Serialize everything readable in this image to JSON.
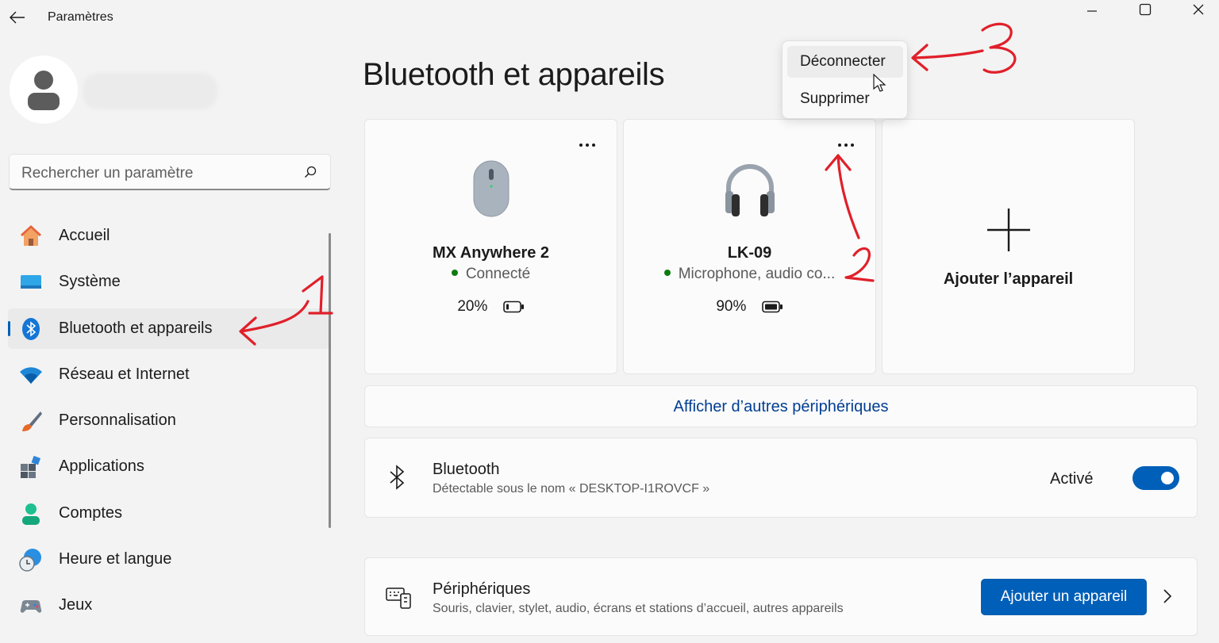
{
  "window": {
    "title": "Paramètres",
    "back_icon": "back-arrow-icon",
    "controls": [
      "minimize-icon",
      "maximize-icon",
      "close-icon"
    ]
  },
  "search": {
    "placeholder": "Rechercher un paramètre",
    "icon": "search-icon"
  },
  "sidebar": {
    "items": [
      {
        "label": "Accueil",
        "icon": "home-icon",
        "active": false
      },
      {
        "label": "Système",
        "icon": "system-icon",
        "active": false
      },
      {
        "label": "Bluetooth et appareils",
        "icon": "bluetooth-icon",
        "active": true
      },
      {
        "label": "Réseau et Internet",
        "icon": "wifi-icon",
        "active": false
      },
      {
        "label": "Personnalisation",
        "icon": "brush-icon",
        "active": false
      },
      {
        "label": "Applications",
        "icon": "apps-icon",
        "active": false
      },
      {
        "label": "Comptes",
        "icon": "person-icon",
        "active": false
      },
      {
        "label": "Heure et langue",
        "icon": "clock-globe-icon",
        "active": false
      },
      {
        "label": "Jeux",
        "icon": "gamepad-icon",
        "active": false
      }
    ]
  },
  "main": {
    "title": "Bluetooth et appareils",
    "devices": [
      {
        "name": "MX Anywhere 2",
        "status": "Connecté",
        "battery": "20%",
        "battery_level": 0.2,
        "icon": "mouse-icon"
      },
      {
        "name": "LK-09",
        "status": "Microphone, audio co...",
        "battery": "90%",
        "battery_level": 0.9,
        "icon": "headphones-icon"
      }
    ],
    "add_device_card": {
      "label": "Ajouter l’appareil",
      "icon": "plus-icon"
    },
    "more_devices_link": "Afficher d’autres périphériques",
    "bluetooth_row": {
      "title": "Bluetooth",
      "subtitle": "Détectable sous le nom « DESKTOP-I1ROVCF »",
      "state": "Activé",
      "enabled": true
    },
    "peripherals_row": {
      "title": "Périphériques",
      "subtitle": "Souris, clavier, stylet, audio, écrans et stations d’accueil, autres appareils",
      "button": "Ajouter un appareil"
    }
  },
  "context_menu": {
    "items": [
      "Déconnecter",
      "Supprimer"
    ],
    "hovered": "Déconnecter"
  },
  "annotations": [
    "1",
    "2",
    "3"
  ],
  "colors": {
    "accent": "#005fb8",
    "link": "#003e92",
    "annotation": "#e0202a",
    "status_green": "#0f7b0f"
  }
}
